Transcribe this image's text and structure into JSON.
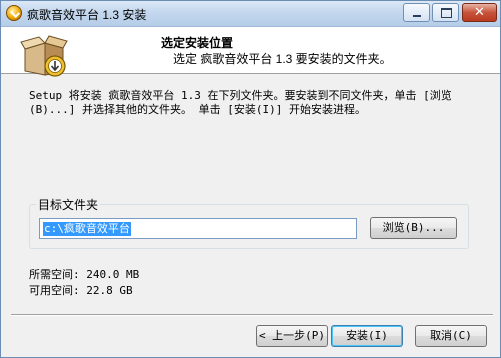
{
  "window": {
    "title": "疯歌音效平台 1.3 安装"
  },
  "header": {
    "title": "选定安装位置",
    "subtitle": "选定 疯歌音效平台 1.3 要安装的文件夹。",
    "icon": "installer-box-icon"
  },
  "description": {
    "line1": "Setup 将安装 疯歌音效平台 1.3 在下列文件夹。要安装到不同文件夹，单击 [浏览",
    "line2": "(B)...] 并选择其他的文件夹。 单击 [安装(I)] 开始安装进程。"
  },
  "target": {
    "group_label": "目标文件夹",
    "path_value": "c:\\疯歌音效平台",
    "browse_label": "浏览(B)..."
  },
  "space": {
    "required": "所需空间: 240.0 MB",
    "available": "可用空间: 22.8 GB"
  },
  "buttons": {
    "back": "< 上一步(P)",
    "install": "安装(I)",
    "cancel": "取消(C)"
  },
  "colors": {
    "selection": "#3399ff",
    "titlebar": "#c3d7ee",
    "close_button": "#c7533a"
  }
}
